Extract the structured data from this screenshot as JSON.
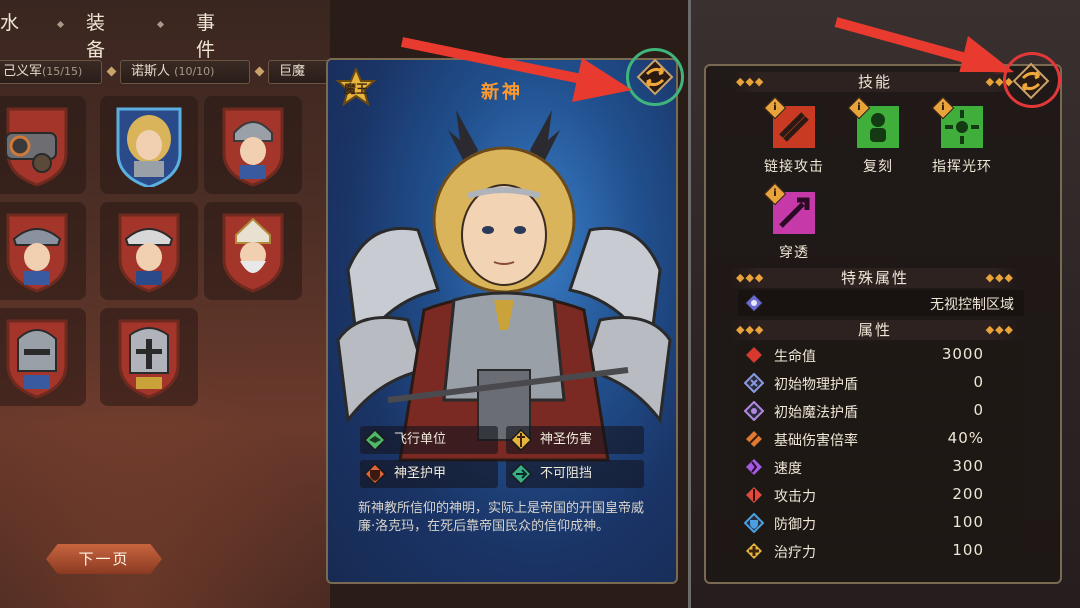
{
  "tabs": [
    "水",
    "装备",
    "事件"
  ],
  "factions": [
    {
      "name": "起义军",
      "count": "(15/15)",
      "shown": "起义军",
      "visible_prefix": "己义军"
    },
    {
      "name": "诺斯人",
      "count": "(10/10)"
    },
    {
      "name": "巨魔",
      "count": ""
    }
  ],
  "next_page_label": "下一页",
  "card": {
    "title": "新神",
    "badge": "魔王",
    "traits": [
      {
        "label": "飞行单位",
        "icon": "flying-unit-icon",
        "color": "#4fb86a"
      },
      {
        "label": "神圣伤害",
        "icon": "holy-damage-icon",
        "color": "#e8b43a"
      },
      {
        "label": "神圣护甲",
        "icon": "holy-armor-icon",
        "color": "#e2653a"
      },
      {
        "label": "不可阻挡",
        "icon": "unstoppable-icon",
        "color": "#3ab08a"
      }
    ],
    "description": "新神教所信仰的神明，实际上是帝国的开国皇帝威廉·洛克玛，在死后靠帝国民众的信仰成神。"
  },
  "right": {
    "skills_header": "技能",
    "skills": [
      {
        "label": "链接攻击",
        "icon": "chain-attack-icon",
        "color": "#e0472a"
      },
      {
        "label": "复刻",
        "icon": "replicate-icon",
        "color": "#3fae3a"
      },
      {
        "label": "指挥光环",
        "icon": "command-aura-icon",
        "color": "#3fae3a"
      },
      {
        "label": "穿透",
        "icon": "pierce-icon",
        "color": "#c53aa8"
      }
    ],
    "special_header": "特殊属性",
    "special": {
      "label": "无视控制区域",
      "icon": "ignore-zoc-icon"
    },
    "attr_header": "属性",
    "attributes": [
      {
        "name": "生命值",
        "value": "3000",
        "icon": "health-icon",
        "color": "#d8392e"
      },
      {
        "name": "初始物理护盾",
        "value": "0",
        "icon": "physical-shield-icon",
        "color": "#8a9ae0"
      },
      {
        "name": "初始魔法护盾",
        "value": "0",
        "icon": "magic-shield-icon",
        "color": "#b08ae0"
      },
      {
        "name": "基础伤害倍率",
        "value": "40%",
        "icon": "damage-multiplier-icon",
        "color": "#e07a2e"
      },
      {
        "name": "速度",
        "value": "300",
        "icon": "speed-icon",
        "color": "#a65ae0"
      },
      {
        "name": "攻击力",
        "value": "200",
        "icon": "attack-icon",
        "color": "#e04a3a"
      },
      {
        "name": "防御力",
        "value": "100",
        "icon": "defense-icon",
        "color": "#4aa0e0"
      },
      {
        "name": "治疗力",
        "value": "100",
        "icon": "heal-icon",
        "color": "#e8b43a"
      }
    ]
  },
  "colors": {
    "accent_orange": "#ff9a2e",
    "ring_green": "#3fb47c",
    "ring_red": "#e2383a",
    "arrow_red": "#e83a2e"
  }
}
